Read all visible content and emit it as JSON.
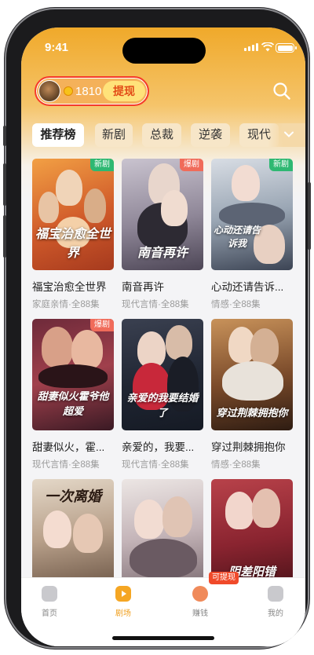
{
  "status": {
    "time": "9:41"
  },
  "header": {
    "coins": "1810",
    "withdraw_label": "提现"
  },
  "tabs": [
    "推荐榜",
    "新剧",
    "总裁",
    "逆袭",
    "现代"
  ],
  "dramas": [
    {
      "title": "福宝治愈全世界",
      "meta": "家庭亲情·全88集",
      "badge": "新剧",
      "poster_text": "福宝治愈全世界"
    },
    {
      "title": "南音再许",
      "meta": "现代言情·全88集",
      "badge": "爆剧",
      "poster_text": "南音再许"
    },
    {
      "title": "心动还请告诉...",
      "meta": "情感·全88集",
      "badge": "新剧",
      "poster_text": "心动还请告诉我"
    },
    {
      "title": "甜妻似火，霍...",
      "meta": "现代言情·全88集",
      "badge": "爆剧",
      "poster_text": "甜妻似火霍爷他超爱"
    },
    {
      "title": "亲爱的，我要...",
      "meta": "现代言情·全88集",
      "badge": "",
      "poster_text": "亲爱的我要结婚了"
    },
    {
      "title": "穿过荆棘拥抱你",
      "meta": "情感·全88集",
      "badge": "",
      "poster_text": "穿过荆棘拥抱你"
    },
    {
      "title": "",
      "meta": "",
      "badge": "",
      "poster_text": "一次离婚"
    },
    {
      "title": "",
      "meta": "",
      "badge": "",
      "poster_text": ""
    },
    {
      "title": "",
      "meta": "",
      "badge": "",
      "poster_text": "阴差阳错"
    }
  ],
  "bottom_nav": {
    "items": [
      "首页",
      "剧场",
      "赚钱",
      "我的"
    ],
    "earn_tag": "可提现"
  },
  "colors": {
    "accent": "#f5a623",
    "badge_new": "#2eb872",
    "badge_hot": "#f06b5a"
  }
}
